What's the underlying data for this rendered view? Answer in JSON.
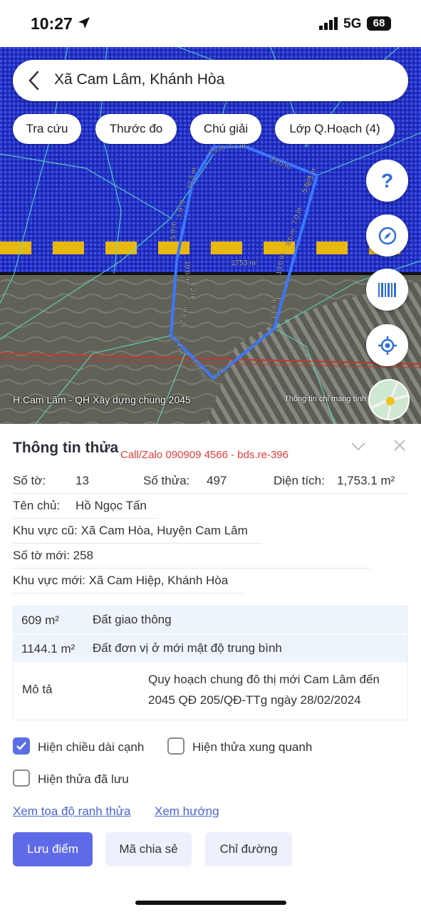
{
  "status_bar": {
    "time": "10:27",
    "network": "5G",
    "battery": "68"
  },
  "search": {
    "title": "Xã Cam Lâm, Khánh Hòa"
  },
  "chips": [
    "Tra cứu",
    "Thước đo",
    "Chú giải",
    "Lớp Q.Hoạch (4)"
  ],
  "map": {
    "layer_label": "H.Cam Lâm - QH Xây dựng chung 2045",
    "info_label": "Thông tin chỉ mang tính",
    "area_label": "1753 m²",
    "edge_labels": [
      "7.9 m",
      "4.1 m",
      "23.0 m",
      "12.3 m",
      "7.9 m",
      "5.9 m",
      "5.6 m",
      "8.3 m",
      "7.0 m",
      "3.6 m",
      "10.6 m",
      "13.0 m",
      "8.2 m",
      "13.5 m",
      "12.3 m",
      "12.7 m",
      "2.4 m",
      "15.0 m",
      "12.6 m"
    ]
  },
  "panel": {
    "heading": "Thông tin thửa",
    "promo": "Call/Zalo 090909 4566 - bds.re-396",
    "so_to_label": "Số tờ:",
    "so_to_value": "13",
    "so_thua_label": "Số thửa:",
    "so_thua_value": "497",
    "dien_tich_label": "Diện tích:",
    "dien_tich_value": "1,753.1 m²",
    "chu_label": "Tên chủ:",
    "chu_value": "Hồ Ngọc Tấn",
    "kv_cu": "Khu vực cũ: Xã Cam Hòa, Huyện Cam Lâm",
    "so_to_moi": "Số tờ mới: 258",
    "kv_moi": "Khu vực mới: Xã Cam Hiệp, Khánh Hòa"
  },
  "land_use": [
    {
      "area": "609 m²",
      "type": "Đất giao thông"
    },
    {
      "area": "1144.1 m²",
      "type": "Đất đơn vị ở mới mật độ trung bình"
    }
  ],
  "description": {
    "label": "Mô tả",
    "text": "Quy hoạch chung đô thị mới Cam Lâm đến 2045 QĐ 205/QĐ-TTg ngày 28/02/2024"
  },
  "options": {
    "show_edges": {
      "label": "Hiện chiều dài cạnh",
      "checked": true
    },
    "show_neighbors": {
      "label": "Hiện thửa xung quanh",
      "checked": false
    },
    "show_saved": {
      "label": "Hiện thửa đã lưu",
      "checked": false
    }
  },
  "links": {
    "coords": "Xem tọa độ ranh thửa",
    "direction": "Xem hướng"
  },
  "buttons": {
    "save": "Lưu điểm",
    "share": "Mã chia sẻ",
    "route": "Chỉ đường"
  },
  "colors": {
    "accent": "#5e6ae8",
    "plan_blue": "#2230c8",
    "promo_red": "#e63a3a",
    "parcel_line": "#3a78ff"
  },
  "icons": {
    "back": "back-arrow-icon",
    "help": "question-icon",
    "compass": "compass-icon",
    "barcode": "barcode-icon",
    "locate": "locate-icon"
  }
}
